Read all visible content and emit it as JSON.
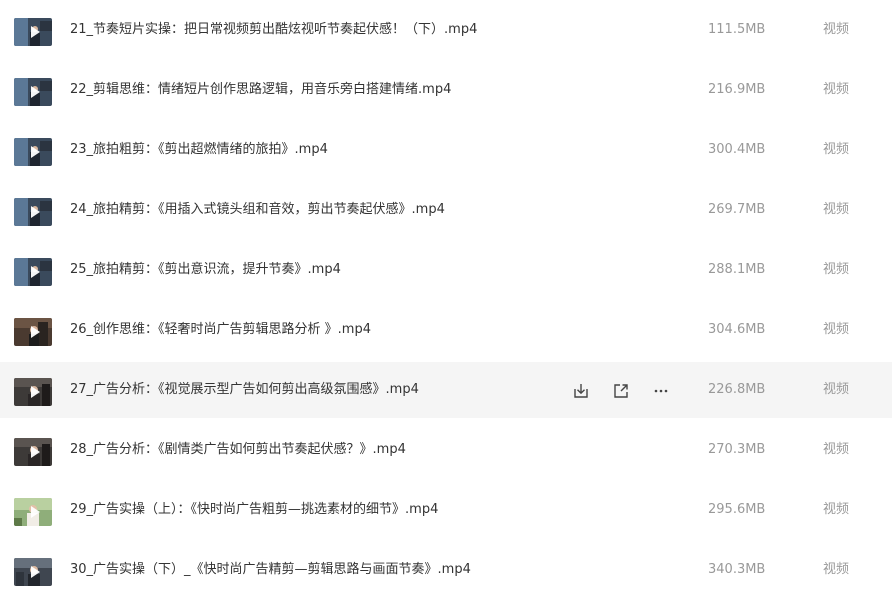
{
  "colors": {
    "row_hover_bg": "#f5f5f5",
    "name_text": "#333333",
    "meta_text": "#999999"
  },
  "row_actions": {
    "download_icon": "download-icon",
    "share_icon": "share-icon",
    "more_label": "···"
  },
  "files": [
    {
      "name": "21_节奏短片实操：把日常视频剪出酷炫视听节奏起伏感！（下）.mp4",
      "size": "111.5MB",
      "type": "视频"
    },
    {
      "name": "22_剪辑思维：情绪短片创作思路逻辑，用音乐旁白搭建情绪.mp4",
      "size": "216.9MB",
      "type": "视频"
    },
    {
      "name": "23_旅拍粗剪：《剪出超燃情绪的旅拍》.mp4",
      "size": "300.4MB",
      "type": "视频"
    },
    {
      "name": "24_旅拍精剪：《用插入式镜头组和音效，剪出节奏起伏感》.mp4",
      "size": "269.7MB",
      "type": "视频"
    },
    {
      "name": "25_旅拍精剪：《剪出意识流，提升节奏》.mp4",
      "size": "288.1MB",
      "type": "视频"
    },
    {
      "name": "26_创作思维：《轻奢时尚广告剪辑思路分析 》.mp4",
      "size": "304.6MB",
      "type": "视频"
    },
    {
      "name": "27_广告分析：《视觉展示型广告如何剪出高级氛围感》.mp4",
      "size": "226.8MB",
      "type": "视频"
    },
    {
      "name": "28_广告分析：《剧情类广告如何剪出节奏起伏感？》.mp4",
      "size": "270.3MB",
      "type": "视频"
    },
    {
      "name": "29_广告实操（上）：《快时尚广告粗剪—挑选素材的细节》.mp4",
      "size": "295.6MB",
      "type": "视频"
    },
    {
      "name": "30_广告实操（下）_《快时尚广告精剪—剪辑思路与画面节奏》.mp4",
      "size": "340.3MB",
      "type": "视频"
    }
  ]
}
